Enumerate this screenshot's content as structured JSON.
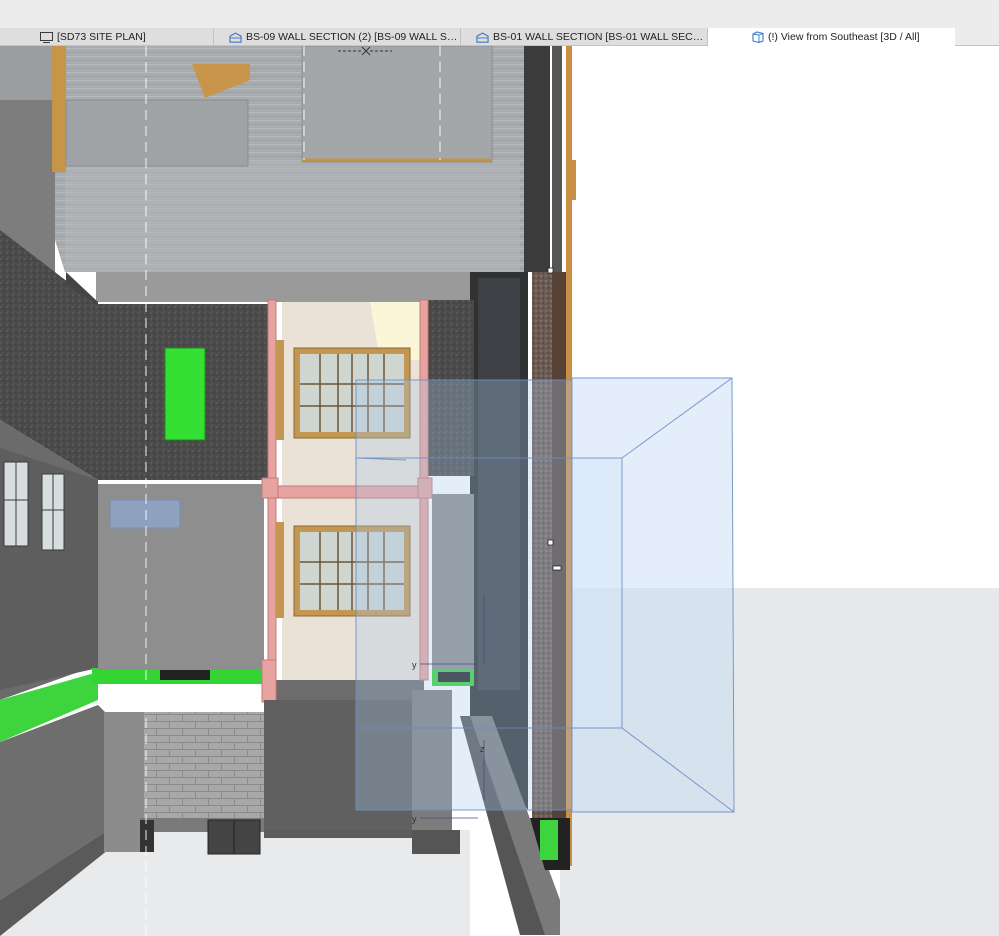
{
  "tabs": [
    {
      "label": "[SD73 SITE PLAN]",
      "icon": "floor-plan-icon",
      "active": false
    },
    {
      "label": "BS-09 WALL SECTION (2) [BS-09 WALL SECTIO...",
      "icon": "section-view-icon",
      "active": false
    },
    {
      "label": "BS-01 WALL SECTION [BS-01 WALL SECTION]",
      "icon": "section-view-icon",
      "active": false
    },
    {
      "label": "(!) View from Southeast [3D / All]",
      "icon": "3d-view-icon",
      "active": true
    }
  ],
  "viewport": {
    "axis_markers": [
      "y",
      "y",
      "z"
    ]
  },
  "colors": {
    "accent_blue": "#3a78c9",
    "selection_fill": "#9ec3ee",
    "wall_gray": "#8e8e8e",
    "concrete_dark": "#555555",
    "green_marker": "#33cc33",
    "timber_frame": "#e3a0a0",
    "wood_trim": "#c89a4e"
  }
}
